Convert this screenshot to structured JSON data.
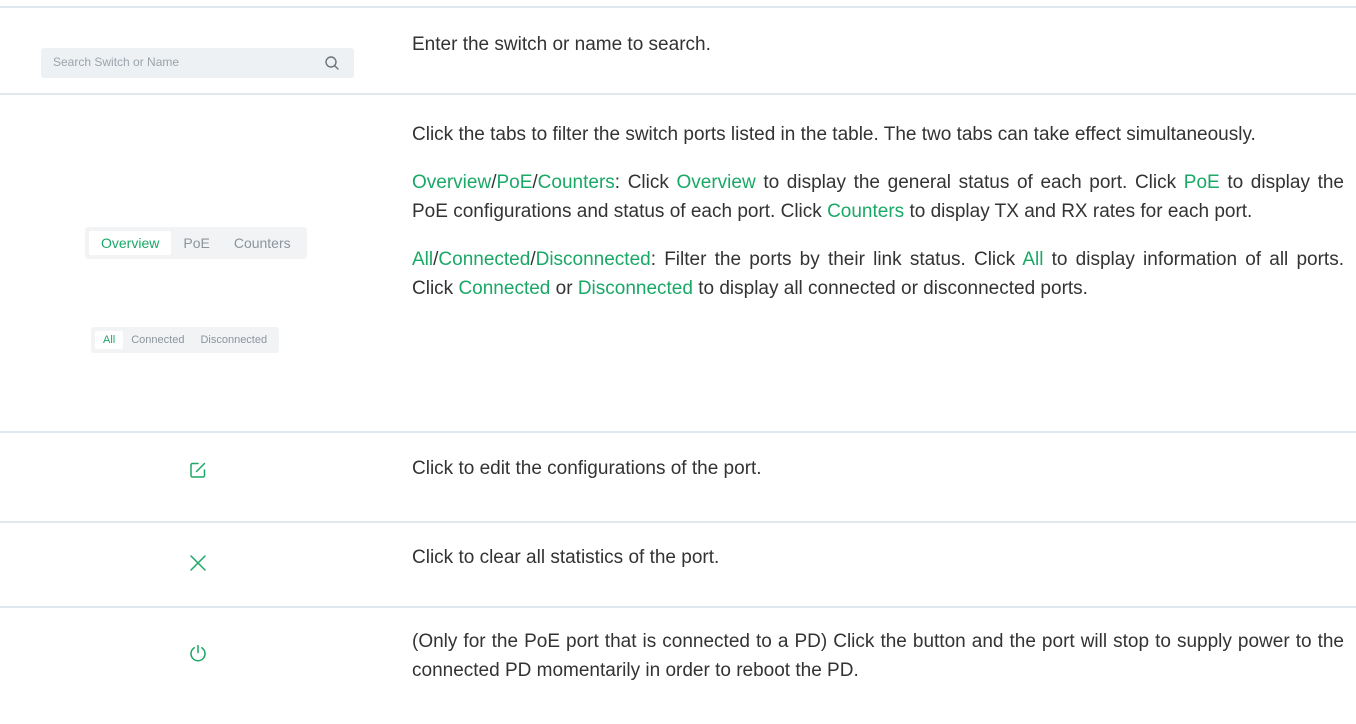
{
  "search": {
    "placeholder": "Search Switch or Name",
    "description": "Enter the switch or name to search."
  },
  "tabs_row": {
    "tabs_a": [
      "Overview",
      "PoE",
      "Counters"
    ],
    "tabs_a_active": "Overview",
    "tabs_b": [
      "All",
      "Connected",
      "Disconnected"
    ],
    "tabs_b_active": "All",
    "intro": "Click the tabs to filter the switch ports listed in the table. The two tabs can take effect simultaneously.",
    "p2": {
      "t1": "Overview",
      "t2": "/",
      "t3": "PoE",
      "t4": "/",
      "t5": "Counters",
      "t6": ": Click ",
      "t7": "Overview",
      "t8": " to display the general status of each port. Click ",
      "t9": "PoE",
      "t10": " to display the PoE configurations and status of each port. Click ",
      "t11": "Counters",
      "t12": " to display TX and RX rates for each port."
    },
    "p3": {
      "t1": "All",
      "t2": "/",
      "t3": "Connected",
      "t4": "/",
      "t5": "Disconnected",
      "t6": ": Filter the ports by their link status. Click ",
      "t7": "All",
      "t8": " to display information of all ports. Click ",
      "t9": "Connected",
      "t10": " or ",
      "t11": "Disconnected",
      "t12": " to display all connected or disconnected ports."
    }
  },
  "edit_row": {
    "icon": "edit-icon",
    "description": "Click to edit the configurations of the port."
  },
  "clear_row": {
    "icon": "close-icon",
    "description": "Click to clear all statistics of the port."
  },
  "power_row": {
    "icon": "power-icon",
    "description": "(Only for the PoE port that is connected to a PD) Click the button and the port will stop to supply power to the connected PD momentarily in order to reboot the PD."
  },
  "colors": {
    "accent": "#1aa866",
    "divider": "#dfe8ee",
    "text": "#333333"
  }
}
